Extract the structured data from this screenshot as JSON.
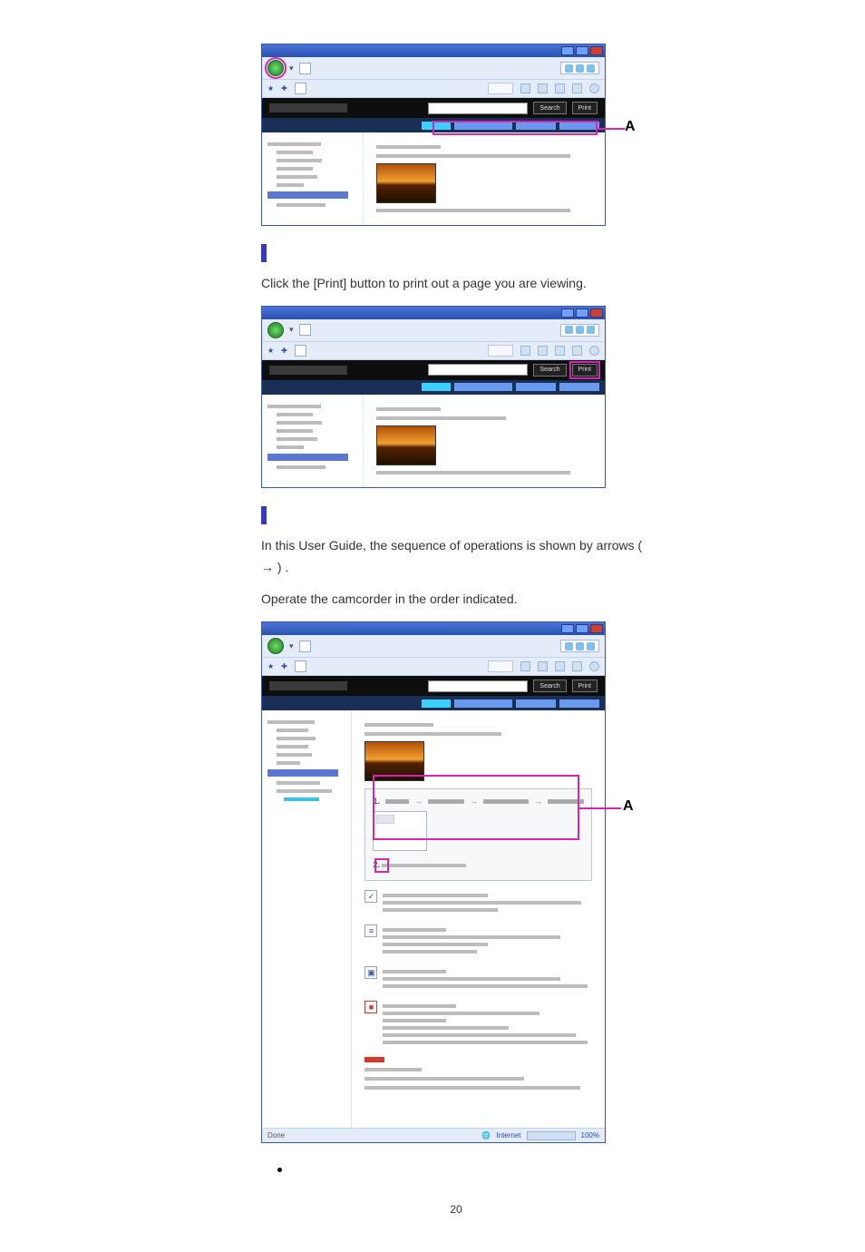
{
  "page_number": "20",
  "section_print": {
    "body": "Click the [Print] button to print out a page you are viewing."
  },
  "section_marks": {
    "body_prefix": "In this User Guide, the sequence of operations is shown by arrows (",
    "arrow_glyph": "→",
    "body_suffix": ")      .",
    "body_line2": "Operate the camcorder in the order indicated."
  },
  "window1": {
    "buttons": {
      "search": "Search",
      "print": "Print"
    },
    "annotation_label": "A"
  },
  "window2": {
    "buttons": {
      "search": "Search",
      "print": "Print"
    }
  },
  "window3": {
    "buttons": {
      "search": "Search",
      "print": "Print"
    },
    "annotation_label": "A",
    "status": {
      "done": "Done",
      "zone": "Internet",
      "zoom": "100%"
    }
  },
  "chart_data": null
}
